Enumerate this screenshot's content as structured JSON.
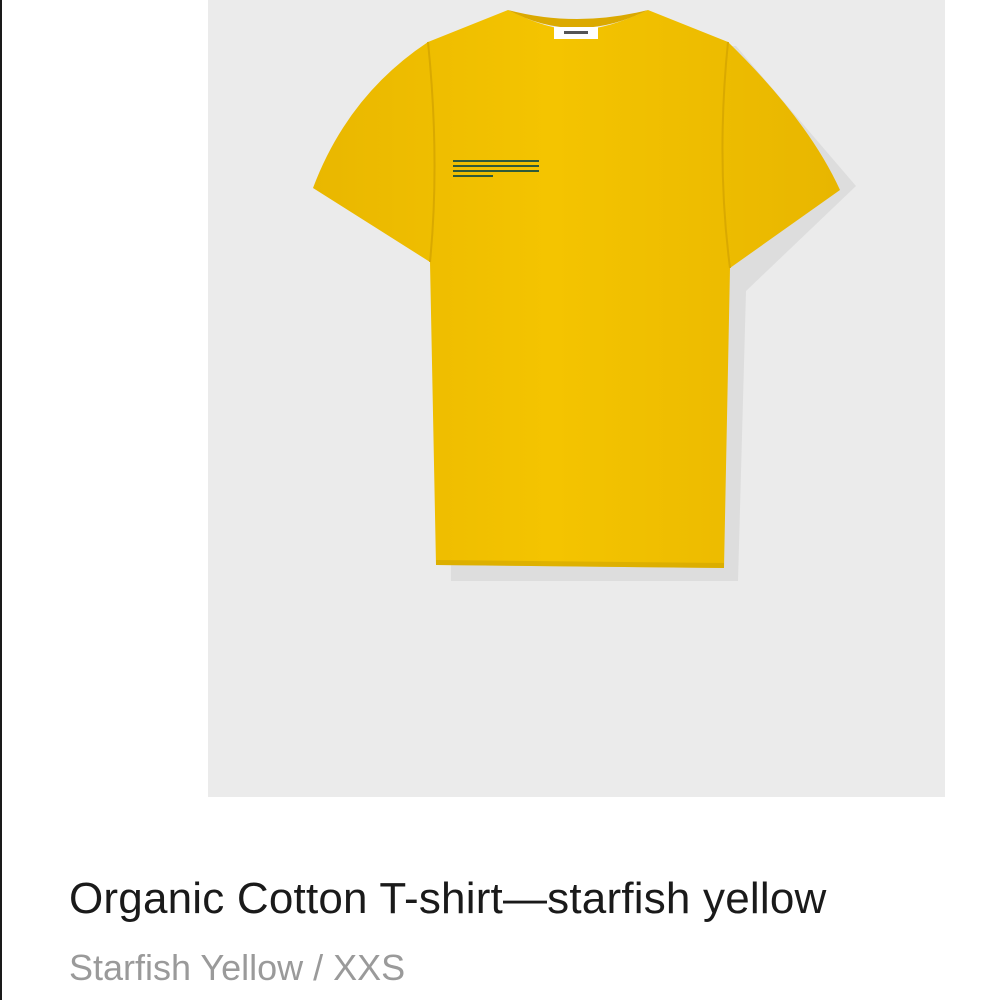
{
  "product": {
    "title": "Organic Cotton T-shirt—starfish yellow",
    "variant": "Starfish Yellow / XXS",
    "image": {
      "subject": "yellow-tshirt",
      "garment_color": "#f2c000",
      "background_color": "#ebebeb"
    }
  }
}
